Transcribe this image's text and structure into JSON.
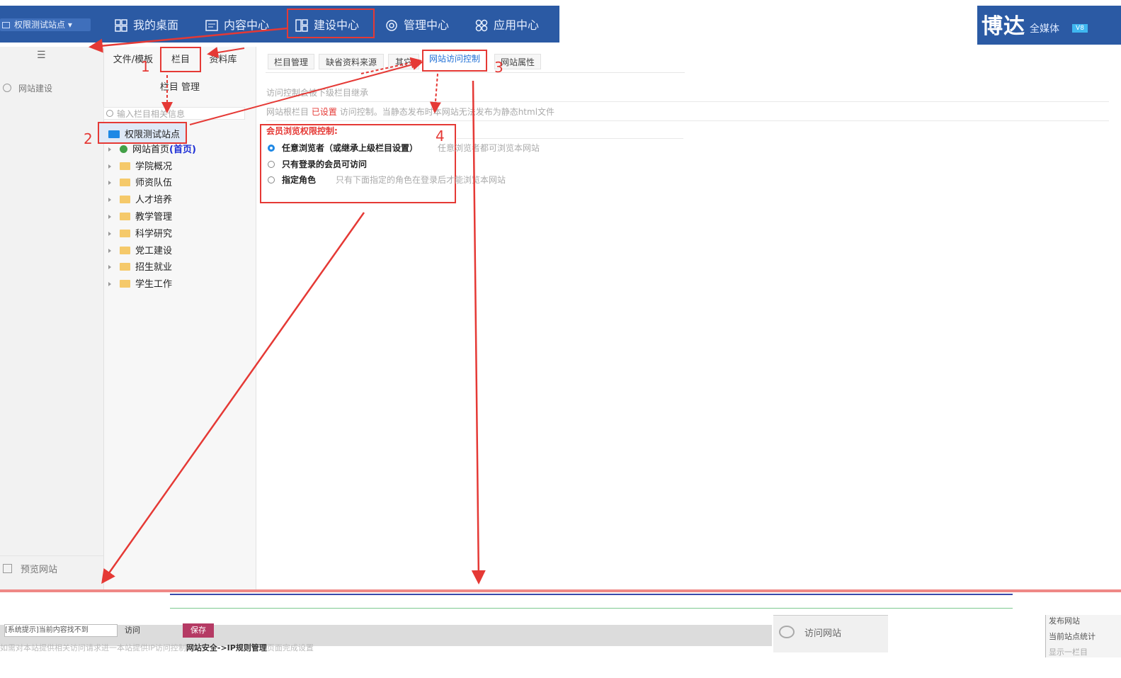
{
  "header": {
    "site_selector": "权限测试站点",
    "nav": [
      {
        "label": "我的桌面",
        "icon": "desktop-grid-icon"
      },
      {
        "label": "内容中心",
        "icon": "document-icon"
      },
      {
        "label": "建设中心",
        "icon": "layout-icon"
      },
      {
        "label": "管理中心",
        "icon": "gear-icon"
      },
      {
        "label": "应用中心",
        "icon": "apps-icon"
      }
    ],
    "brand": {
      "main": "博达",
      "sub": "全媒体",
      "version": "V8"
    }
  },
  "sidebar": {
    "item": "网站建设",
    "bottom": "预览网站"
  },
  "tree_panel": {
    "tabs": [
      "文件/模板",
      "栏目",
      "资料库"
    ],
    "title": "栏目 管理",
    "search_placeholder": "输入栏目相关信息",
    "root": "权限测试站点",
    "nodes": [
      {
        "label": "网站首页",
        "tag": "(首页)"
      },
      {
        "label": "学院概况"
      },
      {
        "label": "师资队伍"
      },
      {
        "label": "人才培养"
      },
      {
        "label": "教学管理"
      },
      {
        "label": "科学研究"
      },
      {
        "label": "党工建设"
      },
      {
        "label": "招生就业"
      },
      {
        "label": "学生工作"
      }
    ]
  },
  "content": {
    "tabs": [
      "栏目管理",
      "缺省资料来源",
      "其它",
      "网站访问控制",
      "网站属性"
    ],
    "line1": "访问控制会被下级栏目继承",
    "line2_prefix": "网站根栏目",
    "line2_status": "已设置",
    "line2_suffix": "访问控制。当静态发布时本网站无法发布为静态html文件",
    "permission": {
      "title": "会员浏览权限控制:",
      "options": [
        {
          "label": "任意浏览者（或继承上级栏目设置）",
          "hint": "任意浏览者都可浏览本网站",
          "checked": true
        },
        {
          "label": "只有登录的会员可访问",
          "hint": "",
          "checked": false
        },
        {
          "label": "指定角色",
          "hint": "只有下面指定的角色在登录后才能浏览本网站",
          "checked": false
        }
      ]
    }
  },
  "annotations": [
    "1",
    "2",
    "3",
    "4"
  ],
  "bottom": {
    "input_value": "[系统提示]当前内容找不到",
    "label": "访问",
    "save": "保存",
    "tip_prefix": "如需对本站提供相关访问请求进一本站提供IP访问控制",
    "tip_link": "网站安全->IP规则管理",
    "tip_suffix": "页面完成设置",
    "visit": "访问网站",
    "right_1": "发布网站",
    "right_2": "当前站点统计",
    "right_3": "显示一栏目"
  },
  "colors": {
    "topbar": "#2b5aa4",
    "annotation_red": "#e53935",
    "radio_blue": "#1e88e5",
    "save_button": "#b53a64"
  }
}
